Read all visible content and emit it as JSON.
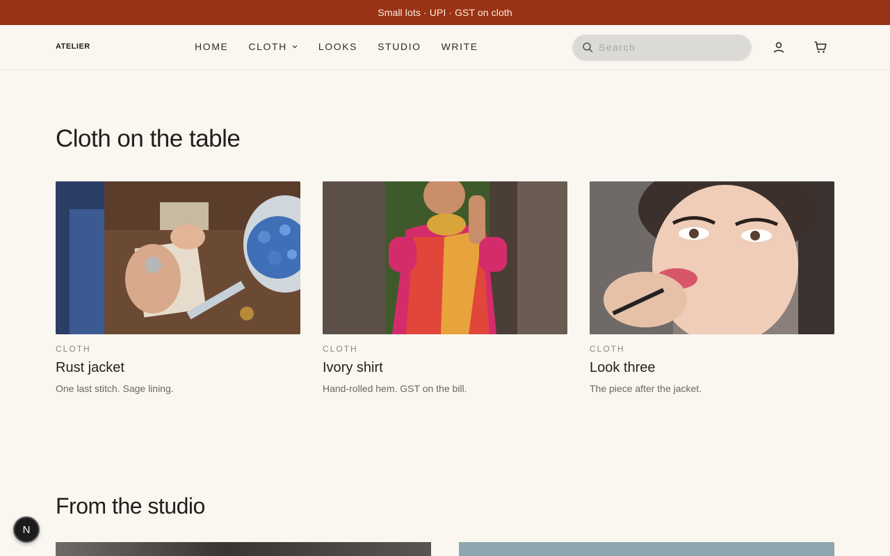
{
  "announcement": "Small lots · UPI · GST on cloth",
  "header": {
    "logo": "ATELIER",
    "nav": [
      {
        "label": "HOME"
      },
      {
        "label": "CLOTH"
      },
      {
        "label": "LOOKS"
      },
      {
        "label": "STUDIO"
      },
      {
        "label": "WRITE"
      }
    ],
    "search_placeholder": "Search"
  },
  "section1": {
    "title": "Cloth on the table",
    "cards": [
      {
        "category": "CLOTH",
        "title": "Rust jacket",
        "desc": "One last stitch. Sage lining."
      },
      {
        "category": "CLOTH",
        "title": "Ivory shirt",
        "desc": "Hand-rolled hem. GST on the bill."
      },
      {
        "category": "CLOTH",
        "title": "Look three",
        "desc": "The piece after the jacket."
      }
    ]
  },
  "section2": {
    "title": "From the studio"
  },
  "badge": "N",
  "colors": {
    "announce_bg": "#9a3215",
    "page_bg": "#faf7f1",
    "text": "#221e1b"
  }
}
